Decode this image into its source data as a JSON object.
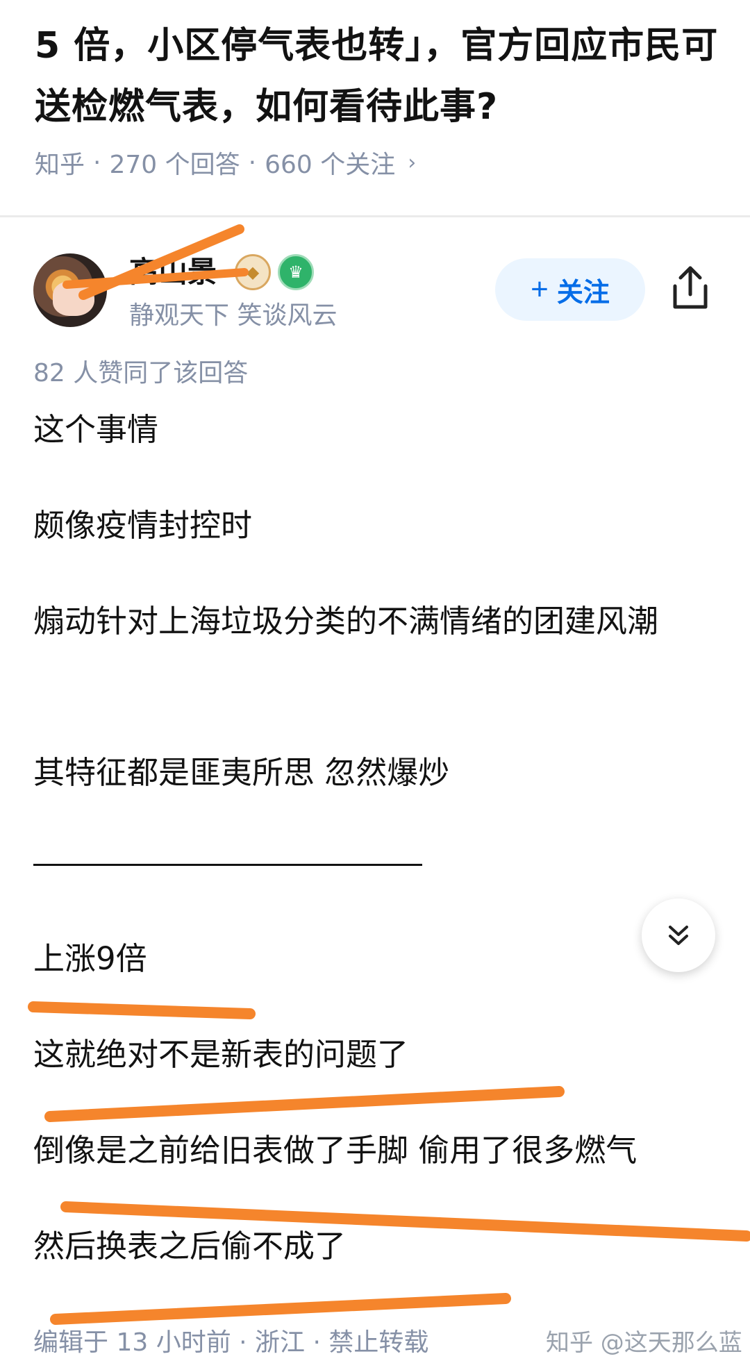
{
  "question": {
    "title": "5 倍，小区停气表也转」，官方回应市民可送检燃气表，如何看待此事?",
    "source": "知乎",
    "answers_count": "270 个回答",
    "followers_count": "660 个关注"
  },
  "author": {
    "name": "高山景",
    "bio": "静观天下 笑谈风云",
    "follow_label": "关注"
  },
  "answer": {
    "likes": "82 人赞同了该回答",
    "paragraphs": [
      "这个事情",
      "颇像疫情封控时",
      "煽动针对上海垃圾分类的不满情绪的团建风潮",
      "其特征都是匪夷所思 忽然爆炒",
      "上涨9倍",
      "这就绝对不是新表的问题了",
      "倒像是之前给旧表做了手脚 偷用了很多燃气",
      "然后换表之后偷不成了"
    ],
    "footer": "编辑于 13 小时前 · 浙江 · 禁止转载"
  },
  "watermark": "知乎 @这天那么蓝",
  "colors": {
    "accent": "#056de8",
    "annotation": "#f5852c",
    "muted": "#8590a6"
  },
  "icons": [
    "chevron-right-icon",
    "plus-icon",
    "share-icon",
    "double-chevron-down-icon"
  ]
}
